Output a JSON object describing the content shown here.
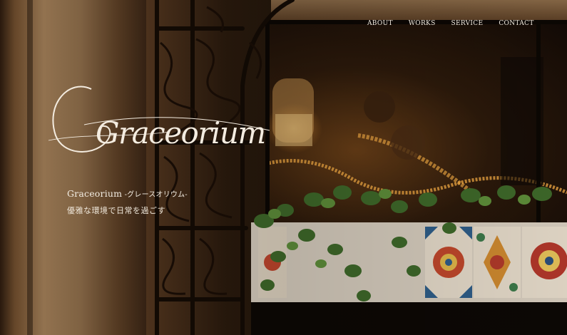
{
  "nav": {
    "items": [
      {
        "label": "ABOUT"
      },
      {
        "label": "WORKS"
      },
      {
        "label": "SERVICE"
      },
      {
        "label": "CONTACT"
      }
    ]
  },
  "hero": {
    "logo_text": "Graceorium",
    "tagline_name": "Graceorium",
    "tagline_suffix": " -グレースオリウム-",
    "tagline_jp": "優雅な環境で日常を過ごす"
  },
  "colors": {
    "text": "#f2ebe0",
    "warm_light": "#f0a040",
    "foliage": "#3f6a2a"
  }
}
